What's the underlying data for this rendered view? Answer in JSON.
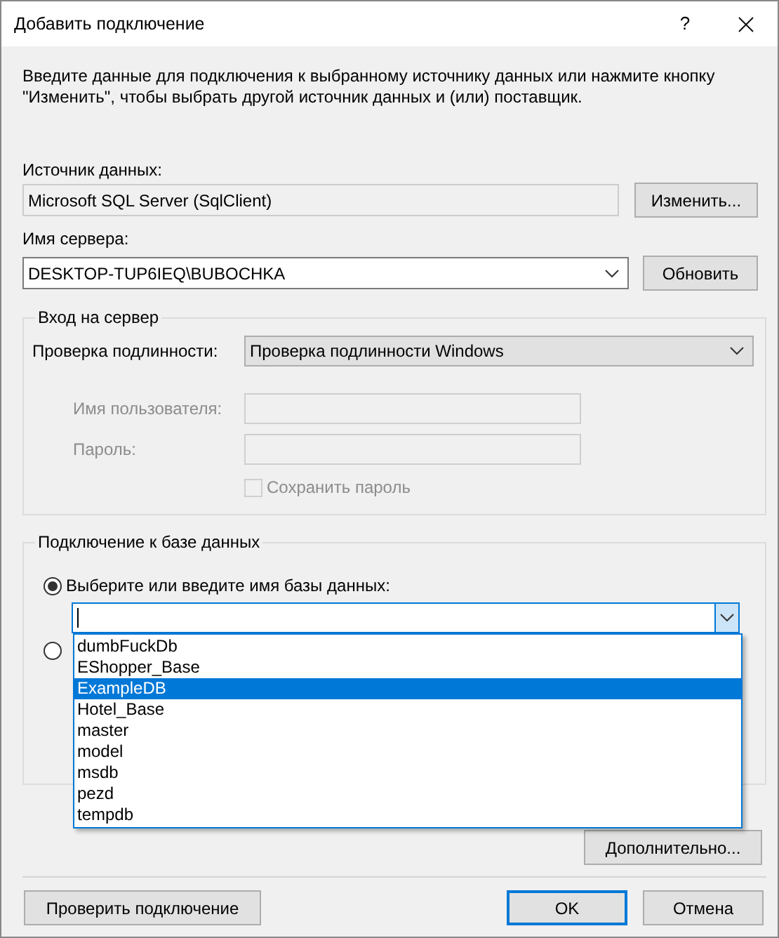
{
  "window": {
    "title": "Добавить подключение",
    "help_button": "?"
  },
  "description": "Введите данные для подключения к выбранному источнику данных или нажмите кнопку \"Изменить\", чтобы выбрать другой источник данных и (или) поставщик.",
  "data_source": {
    "label": "Источник данных:",
    "value": "Microsoft SQL Server (SqlClient)",
    "button": "Изменить..."
  },
  "server": {
    "label": "Имя сервера:",
    "value": "DESKTOP-TUP6IEQ\\BUBOCHKA",
    "button": "Обновить"
  },
  "login_group": {
    "title": "Вход на сервер",
    "auth": {
      "label": "Проверка подлинности:",
      "value": "Проверка подлинности Windows"
    },
    "username": {
      "label": "Имя пользователя:",
      "disabled": true
    },
    "password": {
      "label": "Пароль:",
      "disabled": true
    },
    "save_password": {
      "label": "Сохранить пароль",
      "checked": false,
      "disabled": true
    }
  },
  "database_group": {
    "title": "Подключение к базе данных",
    "options": [
      {
        "label": "Выберите или введите имя базы данных:",
        "selected": true
      },
      {
        "selected": false
      }
    ],
    "dropdown": {
      "expanded": true,
      "items": [
        {
          "label": "dumbFuckDb",
          "selected": false
        },
        {
          "label": "EShopper_Base",
          "selected": false
        },
        {
          "label": "ExampleDB",
          "selected": true
        },
        {
          "label": "Hotel_Base",
          "selected": false
        },
        {
          "label": "master",
          "selected": false
        },
        {
          "label": "model",
          "selected": false
        },
        {
          "label": "msdb",
          "selected": false
        },
        {
          "label": "pezd",
          "selected": false
        },
        {
          "label": "tempdb",
          "selected": false
        }
      ]
    }
  },
  "advanced_button": "Дополнительно...",
  "buttons": [
    {
      "label": "Проверить подключение",
      "kind": "normal"
    },
    {
      "label": "OK",
      "kind": "default"
    },
    {
      "label": "Отмена",
      "kind": "normal"
    }
  ]
}
